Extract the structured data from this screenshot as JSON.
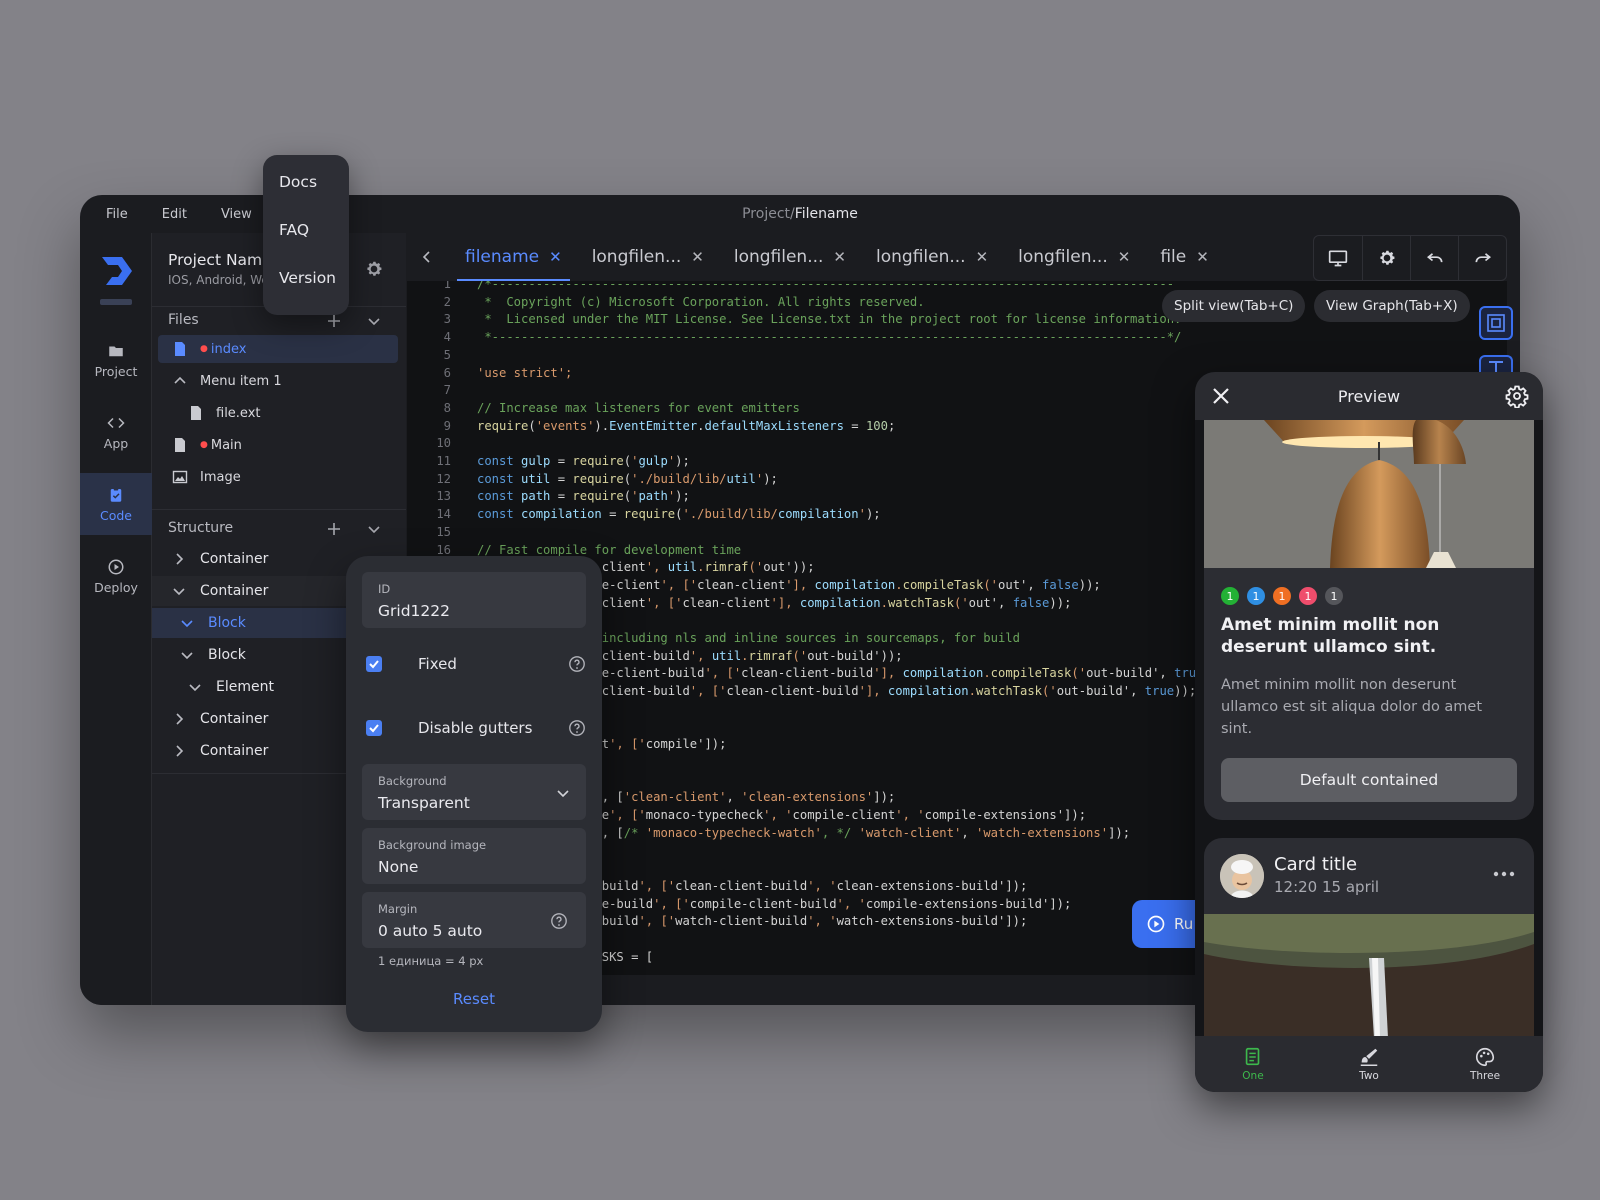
{
  "menubar": {
    "items": [
      "File",
      "Edit",
      "View"
    ]
  },
  "breadcrumb": {
    "path": "Project/",
    "current": "Filename"
  },
  "help_menu": [
    "Docs",
    "FAQ",
    "Version"
  ],
  "rail": {
    "items": [
      {
        "label": "Project",
        "icon": "folder-icon"
      },
      {
        "label": "App",
        "icon": "code-brackets-icon"
      },
      {
        "label": "Code",
        "icon": "clipboard-icon"
      },
      {
        "label": "Deploy",
        "icon": "play-circle-icon"
      }
    ],
    "active": "Code"
  },
  "project": {
    "name": "Project Nam",
    "platforms": "IOS, Android, We"
  },
  "files": {
    "title": "Files",
    "items": [
      "index",
      "Menu item 1",
      "file.ext",
      "Main",
      "Image"
    ]
  },
  "structure": {
    "title": "Structure",
    "items": [
      "Container",
      "Container",
      "Block",
      "Block",
      "Element",
      "Container",
      "Container"
    ]
  },
  "tabs": [
    "filename",
    "longfilen...",
    "longfilen...",
    "longfilen...",
    "longfilen...",
    "file"
  ],
  "actions": {
    "split": "Split view(Tab+C)",
    "graph": "View Graph(Tab+X)",
    "run": "Ru"
  },
  "code": {
    "lines": [
      {
        "n": "1",
        "t": "/*---------------------------------------------------------------------------------------------",
        "k": "com"
      },
      {
        "n": "2",
        "t": " *  Copyright (c) Microsoft Corporation. All rights reserved.",
        "k": "com"
      },
      {
        "n": "3",
        "t": " *  Licensed under the MIT License. See License.txt in the project root for license information.",
        "k": "com"
      },
      {
        "n": "4",
        "t": " *--------------------------------------------------------------------------------------------*/",
        "k": "com"
      },
      {
        "n": "5",
        "t": "",
        "k": "pl"
      },
      {
        "n": "6",
        "t": "'use strict';",
        "k": "str"
      },
      {
        "n": "7",
        "t": "",
        "k": "pl"
      },
      {
        "n": "8",
        "t": "// Increase max listeners for event emitters",
        "k": "com"
      },
      {
        "n": "9",
        "t": "require('events').EventEmitter.defaultMaxListeners = 100;",
        "k": "mix1"
      },
      {
        "n": "10",
        "t": "",
        "k": "pl"
      },
      {
        "n": "11",
        "t": "const gulp = require('gulp');",
        "k": "mix2"
      },
      {
        "n": "12",
        "t": "const util = require('./build/lib/util');",
        "k": "mix2"
      },
      {
        "n": "13",
        "t": "const path = require('path');",
        "k": "mix2"
      },
      {
        "n": "14",
        "t": "const compilation = require('./build/lib/compilation');",
        "k": "mix2"
      },
      {
        "n": "15",
        "t": "",
        "k": "pl"
      },
      {
        "n": "16",
        "t": "// Fast compile for development time",
        "k": "com"
      },
      {
        "n": "",
        "t": "                 client', util.rimraf('out'));",
        "k": "pl"
      },
      {
        "n": "",
        "t": "                 e-client', ['clean-client'], compilation.compileTask('out', false));",
        "k": "pl"
      },
      {
        "n": "",
        "t": "                 client', ['clean-client'], compilation.watchTask('out', false));",
        "k": "pl"
      },
      {
        "n": "",
        "t": "",
        "k": "pl"
      },
      {
        "n": "",
        "t": "                 including nls and inline sources in sourcemaps, for build",
        "k": "com"
      },
      {
        "n": "",
        "t": "                 client-build', util.rimraf('out-build'));",
        "k": "pl"
      },
      {
        "n": "",
        "t": "                 e-client-build', ['clean-client-build'], compilation.compileTask('out-build', true",
        "k": "pl"
      },
      {
        "n": "",
        "t": "                 client-build', ['clean-client-build'], compilation.watchTask('out-build', true));",
        "k": "pl"
      },
      {
        "n": "",
        "t": "",
        "k": "pl"
      },
      {
        "n": "",
        "t": "",
        "k": "pl"
      },
      {
        "n": "",
        "t": "                 t', ['compile']);",
        "k": "pl"
      },
      {
        "n": "",
        "t": "",
        "k": "pl"
      },
      {
        "n": "",
        "t": "",
        "k": "pl"
      },
      {
        "n": "",
        "t": "                 , ['clean-client', 'clean-extensions']);",
        "k": "pl"
      },
      {
        "n": "",
        "t": "                 e', ['monaco-typecheck', 'compile-client', 'compile-extensions']);",
        "k": "pl"
      },
      {
        "n": "",
        "t": "                 , [/* 'monaco-typecheck-watch', */ 'watch-client', 'watch-extensions']);",
        "k": "pl"
      },
      {
        "n": "",
        "t": "",
        "k": "pl"
      },
      {
        "n": "",
        "t": "",
        "k": "pl"
      },
      {
        "n": "",
        "t": "                 build', ['clean-client-build', 'clean-extensions-build']);",
        "k": "pl"
      },
      {
        "n": "",
        "t": "                 e-build', ['compile-client-build', 'compile-extensions-build']);",
        "k": "pl"
      },
      {
        "n": "",
        "t": "                 build', ['watch-client-build', 'watch-extensions-build']);",
        "k": "pl"
      },
      {
        "n": "",
        "t": "",
        "k": "pl"
      },
      {
        "n": "",
        "t": "                 SKS = [",
        "k": "pl"
      }
    ]
  },
  "props": {
    "id_label": "ID",
    "id_value": "Grid1222",
    "fixed_label": "Fixed",
    "gutters_label": "Disable gutters",
    "bg_label": "Background",
    "bg_value": "Transparent",
    "bgimg_label": "Background image",
    "bgimg_value": "None",
    "margin_label": "Margin",
    "margin_value": "0 auto 5 auto",
    "unit_note": "1 единица = 4 px",
    "reset": "Reset"
  },
  "preview": {
    "title": "Preview",
    "card1": {
      "badges": [
        {
          "v": "1",
          "c": "#23b135"
        },
        {
          "v": "1",
          "c": "#2f8fe3"
        },
        {
          "v": "1",
          "c": "#f06f23"
        },
        {
          "v": "1",
          "c": "#ef4d6c"
        },
        {
          "v": "1",
          "c": "#55565b"
        }
      ],
      "title": "Amet minim mollit non deserunt ullamco sint.",
      "body": "Amet minim mollit non deserunt ullamco est sit aliqua dolor do amet sint.",
      "button": "Default contained"
    },
    "card2": {
      "title": "Card title",
      "date": "12:20 15 april"
    },
    "nav": [
      "One",
      "Two",
      "Three"
    ]
  },
  "colors": {
    "accent": "#5a8bff",
    "run": "#3a6ff0",
    "nav_active": "#3db84c"
  }
}
